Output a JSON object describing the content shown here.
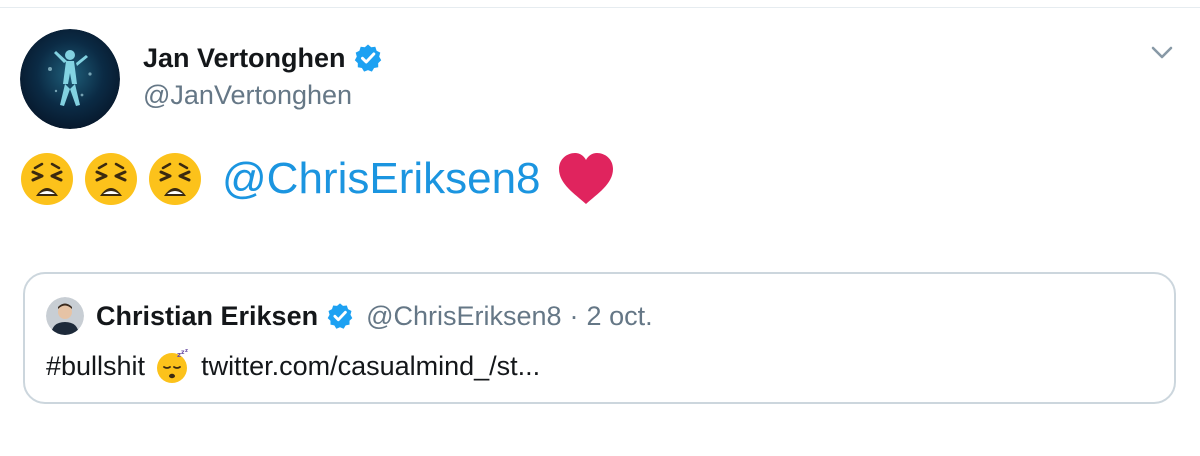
{
  "tweet": {
    "author": {
      "name": "Jan Vertonghen",
      "handle": "@JanVertonghen",
      "verified": true,
      "avatar_icon": "player-avatar"
    },
    "menu_icon": "chevron-down-icon",
    "body": {
      "emojis": [
        "weary-face-emoji",
        "weary-face-emoji",
        "weary-face-emoji"
      ],
      "mention": "@ChrisEriksen8",
      "trailing_emoji": "red-heart-emoji"
    },
    "quoted_tweet": {
      "author_name": "Christian Eriksen",
      "handle": "@ChrisEriksen8",
      "separator": "·",
      "date": "2 oct.",
      "verified": true,
      "hashtag": "#bullshit",
      "inline_emoji": "sleeping-face-emoji",
      "link": "twitter.com/casualmind_/st..."
    }
  },
  "colors": {
    "link_blue": "#1b95e0",
    "verified_blue": "#1da1f2",
    "secondary_text": "#657786",
    "border": "#ccd6dd",
    "heart_red": "#e0245e"
  }
}
